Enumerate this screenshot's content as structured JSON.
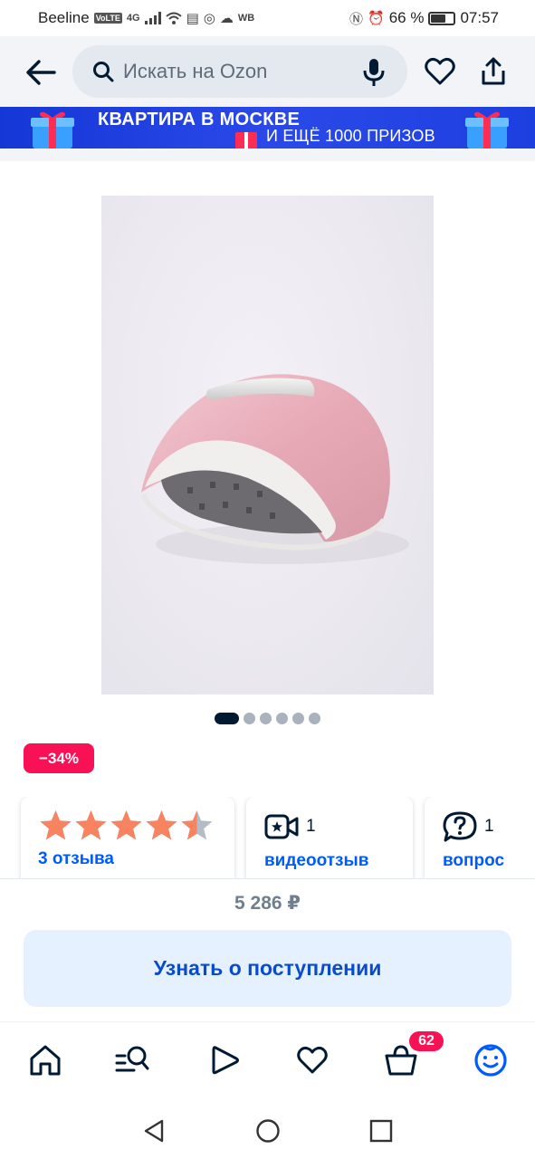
{
  "status_bar": {
    "carrier": "Beeline",
    "volte": "VoLTE",
    "network": "4G",
    "wb": "WB",
    "battery_text": "66 %",
    "battery_level": 0.66,
    "time": "07:57"
  },
  "header": {
    "search_placeholder": "Искать на Ozon",
    "icons": [
      "back-arrow-icon",
      "search-icon",
      "microphone-icon",
      "heart-icon",
      "share-icon"
    ]
  },
  "banner": {
    "line1": "КВАРТИРА В МОСКВЕ",
    "line2": "И ЕЩЁ 1000 ПРИЗОВ",
    "background": "#1e3fe0"
  },
  "gallery": {
    "count": 6,
    "active_index": 0
  },
  "discount_badge": "−34%",
  "cards": {
    "rating": {
      "stars": 4.5,
      "reviews_label": "3 отзыва"
    },
    "video": {
      "count": "1",
      "label": "видеоотзыв"
    },
    "question": {
      "count": "1",
      "label": "вопрос"
    }
  },
  "price": "5 286 ₽",
  "notify_button": "Узнать о поступлении",
  "tabbar": {
    "items": [
      "home-icon",
      "catalog-search-icon",
      "video-play-icon",
      "favorites-icon",
      "cart-icon",
      "profile-icon"
    ],
    "cart_badge": "62",
    "active_color": "#005bff"
  },
  "colors": {
    "brand_blue": "#005bff",
    "discount_pink": "#f91155",
    "text_dark": "#001a34"
  }
}
